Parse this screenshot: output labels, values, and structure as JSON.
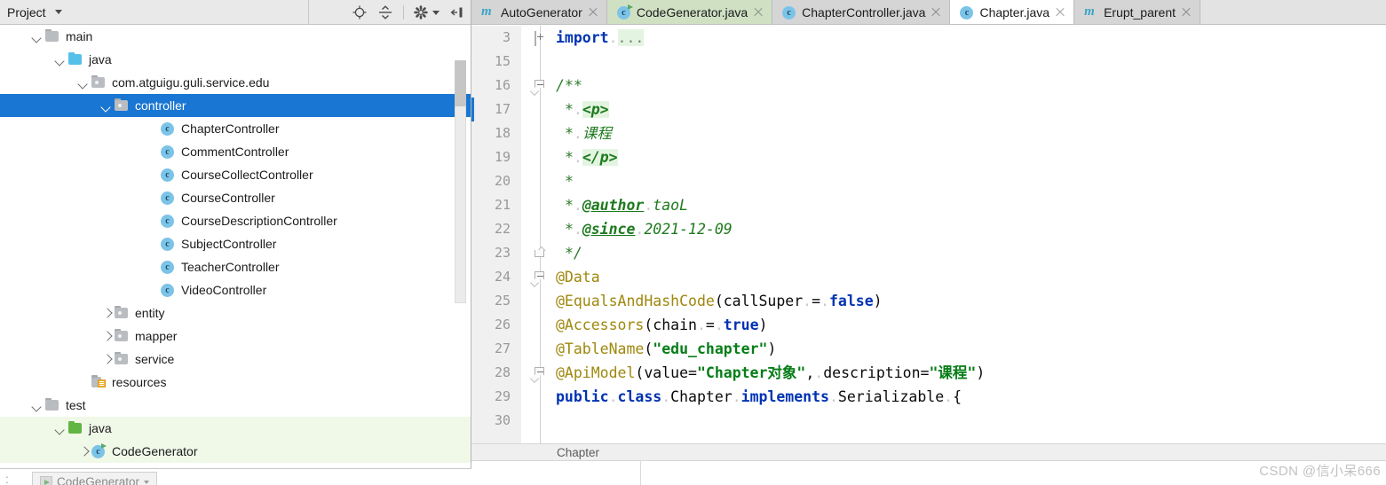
{
  "window": {
    "watermark": "CSDN @信小呆666"
  },
  "sidebar": {
    "title": "Project",
    "tools": [
      {
        "name": "locate-icon",
        "label": "Select Opened File"
      },
      {
        "name": "collapse-all-icon",
        "label": "Collapse All"
      },
      {
        "name": "gear-icon",
        "label": "Settings"
      },
      {
        "name": "hide-panel-icon",
        "label": "Hide"
      }
    ],
    "tree": [
      {
        "label": "main",
        "indent": 0,
        "arrow": "down",
        "icon": "folder",
        "selected": false,
        "testroot": false
      },
      {
        "label": "java",
        "indent": 1,
        "arrow": "down",
        "icon": "folder-src",
        "selected": false,
        "testroot": false
      },
      {
        "label": "com.atguigu.guli.service.edu",
        "indent": 2,
        "arrow": "down",
        "icon": "package",
        "selected": false,
        "testroot": false
      },
      {
        "label": "controller",
        "indent": 3,
        "arrow": "down",
        "icon": "package",
        "selected": true,
        "testroot": false
      },
      {
        "label": "ChapterController",
        "indent": 5,
        "arrow": "none",
        "icon": "class",
        "selected": false,
        "testroot": false
      },
      {
        "label": "CommentController",
        "indent": 5,
        "arrow": "none",
        "icon": "class",
        "selected": false,
        "testroot": false
      },
      {
        "label": "CourseCollectController",
        "indent": 5,
        "arrow": "none",
        "icon": "class",
        "selected": false,
        "testroot": false
      },
      {
        "label": "CourseController",
        "indent": 5,
        "arrow": "none",
        "icon": "class",
        "selected": false,
        "testroot": false
      },
      {
        "label": "CourseDescriptionController",
        "indent": 5,
        "arrow": "none",
        "icon": "class",
        "selected": false,
        "testroot": false
      },
      {
        "label": "SubjectController",
        "indent": 5,
        "arrow": "none",
        "icon": "class",
        "selected": false,
        "testroot": false
      },
      {
        "label": "TeacherController",
        "indent": 5,
        "arrow": "none",
        "icon": "class",
        "selected": false,
        "testroot": false
      },
      {
        "label": "VideoController",
        "indent": 5,
        "arrow": "none",
        "icon": "class",
        "selected": false,
        "testroot": false
      },
      {
        "label": "entity",
        "indent": 3,
        "arrow": "right",
        "icon": "package",
        "selected": false,
        "testroot": false
      },
      {
        "label": "mapper",
        "indent": 3,
        "arrow": "right",
        "icon": "package",
        "selected": false,
        "testroot": false
      },
      {
        "label": "service",
        "indent": 3,
        "arrow": "right",
        "icon": "package",
        "selected": false,
        "testroot": false
      },
      {
        "label": "resources",
        "indent": 2,
        "arrow": "none",
        "icon": "resources",
        "selected": false,
        "testroot": false
      },
      {
        "label": "test",
        "indent": 0,
        "arrow": "down",
        "icon": "folder",
        "selected": false,
        "testroot": false
      },
      {
        "label": "java",
        "indent": 1,
        "arrow": "down",
        "icon": "folder-test",
        "selected": false,
        "testroot": true
      },
      {
        "label": "CodeGenerator",
        "indent": 2,
        "arrow": "right",
        "icon": "class-run",
        "selected": false,
        "testroot": true
      }
    ]
  },
  "run_strip": {
    "prefix": ":",
    "tab_label": "CodeGenerator"
  },
  "editor": {
    "tabs": [
      {
        "label": "AutoGenerator",
        "icon": "maven-icon",
        "state": "inactive"
      },
      {
        "label": "CodeGenerator.java",
        "icon": "class-run-icon",
        "state": "active-green"
      },
      {
        "label": "ChapterController.java",
        "icon": "class-icon",
        "state": "inactive"
      },
      {
        "label": "Chapter.java",
        "icon": "class-icon",
        "state": "active-white"
      },
      {
        "label": "Erupt_parent",
        "icon": "maven-icon",
        "state": "inactive"
      }
    ],
    "breadcrumb": "Chapter",
    "caret_line_index": 3,
    "lines": [
      {
        "num": "3",
        "fold": "plus",
        "tokens": [
          {
            "t": "import",
            "c": "kw"
          },
          {
            "t": ".",
            "c": "dot-sep"
          },
          {
            "t": "...",
            "c": "fold-ph"
          }
        ]
      },
      {
        "num": "15",
        "fold": "",
        "tokens": []
      },
      {
        "num": "16",
        "fold": "top",
        "tokens": [
          {
            "t": "/**",
            "c": "cmt"
          }
        ]
      },
      {
        "num": "17",
        "fold": "",
        "tokens": [
          {
            "t": " ",
            "c": "dot-sep"
          },
          {
            "t": "*",
            "c": "cmt"
          },
          {
            "t": ".",
            "c": "dot-sep"
          },
          {
            "t": "<p>",
            "c": "cmt-html"
          }
        ]
      },
      {
        "num": "18",
        "fold": "",
        "tokens": [
          {
            "t": " ",
            "c": "dot-sep"
          },
          {
            "t": "*",
            "c": "cmt"
          },
          {
            "t": ".",
            "c": "dot-sep"
          },
          {
            "t": "课程",
            "c": "cmt-val"
          }
        ]
      },
      {
        "num": "19",
        "fold": "",
        "tokens": [
          {
            "t": " ",
            "c": "dot-sep"
          },
          {
            "t": "*",
            "c": "cmt"
          },
          {
            "t": ".",
            "c": "dot-sep"
          },
          {
            "t": "</p>",
            "c": "cmt-html"
          }
        ]
      },
      {
        "num": "20",
        "fold": "",
        "tokens": [
          {
            "t": " ",
            "c": "dot-sep"
          },
          {
            "t": "*",
            "c": "cmt"
          }
        ]
      },
      {
        "num": "21",
        "fold": "",
        "tokens": [
          {
            "t": " ",
            "c": "dot-sep"
          },
          {
            "t": "*",
            "c": "cmt"
          },
          {
            "t": ".",
            "c": "dot-sep"
          },
          {
            "t": "@author",
            "c": "cmt-tag"
          },
          {
            "t": ".",
            "c": "dot-sep"
          },
          {
            "t": "taoL",
            "c": "cmt-val"
          }
        ]
      },
      {
        "num": "22",
        "fold": "",
        "tokens": [
          {
            "t": " ",
            "c": "dot-sep"
          },
          {
            "t": "*",
            "c": "cmt"
          },
          {
            "t": ".",
            "c": "dot-sep"
          },
          {
            "t": "@since",
            "c": "cmt-tag"
          },
          {
            "t": ".",
            "c": "dot-sep"
          },
          {
            "t": "2021-12-09",
            "c": "cmt-val"
          }
        ]
      },
      {
        "num": "23",
        "fold": "end",
        "tokens": [
          {
            "t": " ",
            "c": "dot-sep"
          },
          {
            "t": "*/",
            "c": "cmt"
          }
        ]
      },
      {
        "num": "24",
        "fold": "top",
        "tokens": [
          {
            "t": "@Data",
            "c": "anno"
          }
        ]
      },
      {
        "num": "25",
        "fold": "",
        "tokens": [
          {
            "t": "@EqualsAndHashCode",
            "c": "anno"
          },
          {
            "t": "(callSuper",
            "c": ""
          },
          {
            "t": ".",
            "c": "dot-sep"
          },
          {
            "t": "=",
            "c": ""
          },
          {
            "t": ".",
            "c": "dot-sep"
          },
          {
            "t": "false",
            "c": "kw"
          },
          {
            "t": ")",
            "c": ""
          }
        ]
      },
      {
        "num": "26",
        "fold": "",
        "tokens": [
          {
            "t": "@Accessors",
            "c": "anno"
          },
          {
            "t": "(chain",
            "c": ""
          },
          {
            "t": ".",
            "c": "dot-sep"
          },
          {
            "t": "=",
            "c": ""
          },
          {
            "t": ".",
            "c": "dot-sep"
          },
          {
            "t": "true",
            "c": "kw"
          },
          {
            "t": ")",
            "c": ""
          }
        ]
      },
      {
        "num": "27",
        "fold": "",
        "tokens": [
          {
            "t": "@TableName",
            "c": "anno"
          },
          {
            "t": "(",
            "c": ""
          },
          {
            "t": "\"edu_chapter\"",
            "c": "str"
          },
          {
            "t": ")",
            "c": ""
          }
        ]
      },
      {
        "num": "28",
        "fold": "top",
        "tokens": [
          {
            "t": "@ApiModel",
            "c": "anno"
          },
          {
            "t": "(value=",
            "c": ""
          },
          {
            "t": "\"Chapter对象\"",
            "c": "str"
          },
          {
            "t": ",",
            "c": ""
          },
          {
            "t": ".",
            "c": "dot-sep"
          },
          {
            "t": "description=",
            "c": ""
          },
          {
            "t": "\"课程\"",
            "c": "str"
          },
          {
            "t": ")",
            "c": ""
          }
        ]
      },
      {
        "num": "29",
        "fold": "",
        "tokens": [
          {
            "t": "public",
            "c": "kw"
          },
          {
            "t": ".",
            "c": "dot-sep"
          },
          {
            "t": "class",
            "c": "kw"
          },
          {
            "t": ".",
            "c": "dot-sep"
          },
          {
            "t": "Chapter",
            "c": ""
          },
          {
            "t": ".",
            "c": "dot-sep"
          },
          {
            "t": "implements",
            "c": "kw"
          },
          {
            "t": ".",
            "c": "dot-sep"
          },
          {
            "t": "Serializable",
            "c": ""
          },
          {
            "t": ".",
            "c": "dot-sep"
          },
          {
            "t": "{",
            "c": ""
          }
        ]
      },
      {
        "num": "30",
        "fold": "",
        "tokens": []
      }
    ]
  },
  "colors": {
    "selection_blue": "#1976d2",
    "tab_active_green": "#cfe0c3",
    "test_root_green": "#f0f8e8",
    "keyword_blue": "#0033b3",
    "annotation_gold": "#9e880d",
    "string_green": "#067d17",
    "comment_green": "#2a7a2a"
  }
}
